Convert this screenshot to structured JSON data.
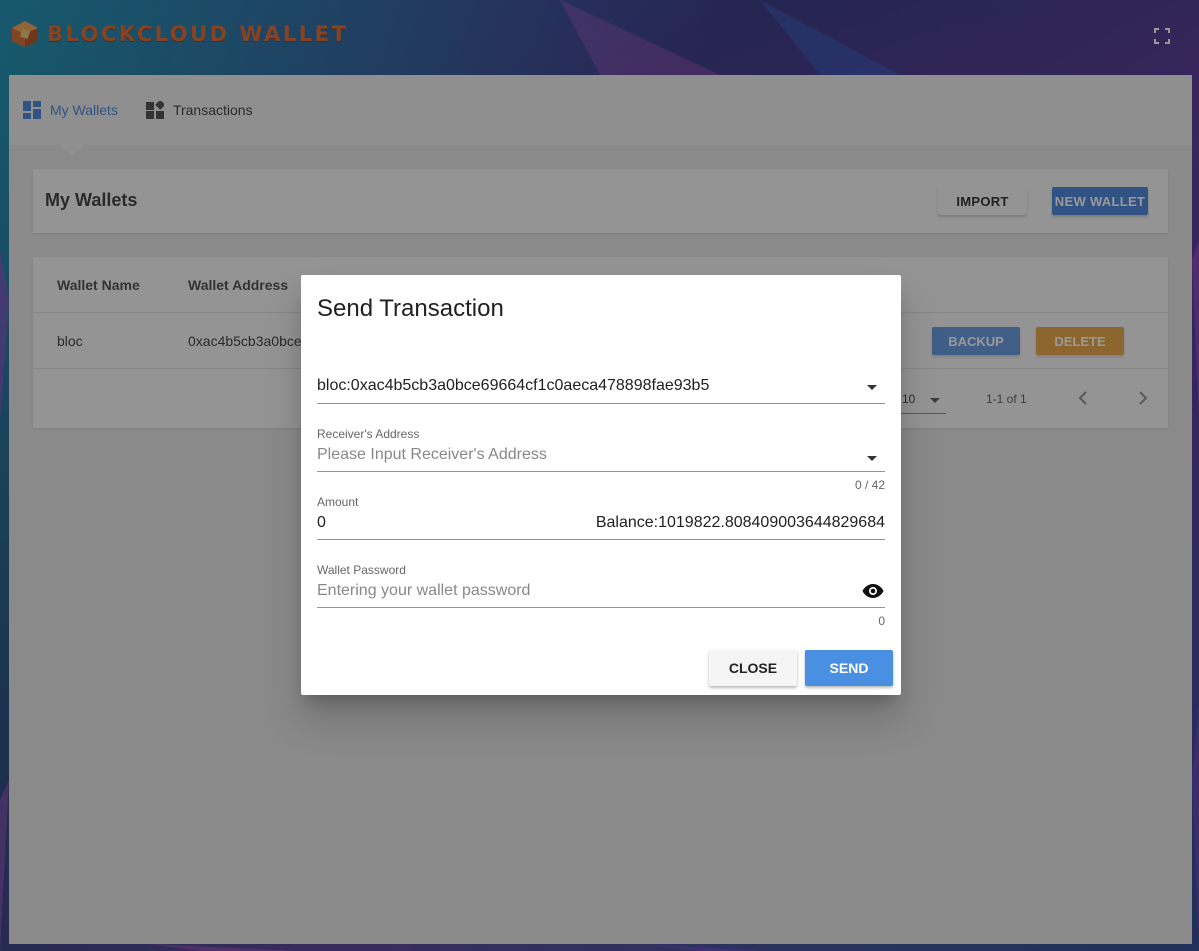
{
  "app": {
    "brand": "BLOCKCLOUD WALLET"
  },
  "nav": {
    "items": [
      {
        "label": "My Wallets",
        "icon": "dashboard-icon",
        "active": true
      },
      {
        "label": "Transactions",
        "icon": "widgets-icon",
        "active": false
      }
    ]
  },
  "wallets_card": {
    "title": "My Wallets",
    "import_label": "IMPORT",
    "new_wallet_label": "NEW WALLET"
  },
  "table": {
    "headers": [
      "Wallet Name",
      "Wallet Address"
    ],
    "rows": [
      {
        "name": "bloc",
        "address": "0xac4b5cb3a0bce",
        "backup_label": "BACKUP",
        "delete_label": "DELETE"
      }
    ],
    "rows_per_page": "10",
    "page_info": "1-1 of 1"
  },
  "dialog": {
    "title": "Send Transaction",
    "selected_wallet": "bloc:0xac4b5cb3a0bce69664cf1c0aeca478898fae93b5",
    "receiver": {
      "label": "Receiver's Address",
      "placeholder": "Please Input Receiver's Address",
      "counter": "0 / 42"
    },
    "amount": {
      "label": "Amount",
      "value": "0",
      "balance": "Balance:1019822.808409003644829684"
    },
    "password": {
      "label": "Wallet Password",
      "placeholder": "Entering your wallet password",
      "counter": "0"
    },
    "close_label": "CLOSE",
    "send_label": "SEND"
  },
  "colors": {
    "accent": "#3f7ed6",
    "send": "#4a90e2",
    "backup": "#5b92dc",
    "delete": "#e8a23a",
    "brand": "#d4622a"
  }
}
